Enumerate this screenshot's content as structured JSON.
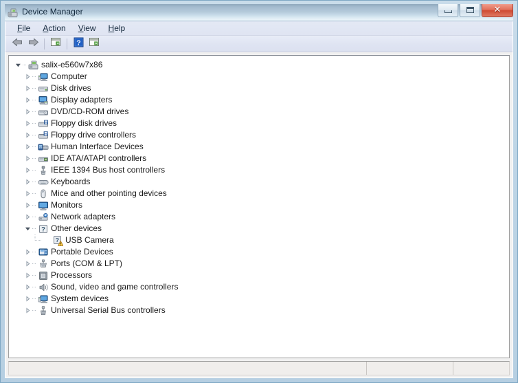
{
  "window": {
    "title": "Device Manager",
    "title_icon": "device-manager-icon",
    "controls": {
      "minimize_label": "Minimize",
      "maximize_label": "Maximize",
      "close_label": "Close",
      "close_glyph": "✕"
    }
  },
  "menubar": {
    "items": [
      {
        "label": "File",
        "accel": "F",
        "name": "menu-file"
      },
      {
        "label": "Action",
        "accel": "A",
        "name": "menu-action"
      },
      {
        "label": "View",
        "accel": "V",
        "name": "menu-view"
      },
      {
        "label": "Help",
        "accel": "H",
        "name": "menu-help"
      }
    ]
  },
  "toolbar": {
    "buttons": [
      {
        "name": "back-button",
        "icon": "back-arrow-icon",
        "label": "Back"
      },
      {
        "name": "forward-button",
        "icon": "forward-arrow-icon",
        "label": "Forward"
      },
      {
        "name": "show-hide-console-tree-button",
        "icon": "console-tree-icon",
        "label": "Show/Hide Console Tree"
      },
      {
        "name": "help-button",
        "icon": "help-question-icon",
        "label": "Help"
      },
      {
        "name": "properties-button",
        "icon": "properties-window-icon",
        "label": "Properties"
      }
    ]
  },
  "tree": {
    "root": {
      "label": "salix-e560w7x86",
      "icon": "computer-root-icon",
      "expanded": true
    },
    "items": [
      {
        "label": "Computer",
        "icon": "computer-icon",
        "expandable": true,
        "expanded": false,
        "level": 1
      },
      {
        "label": "Disk drives",
        "icon": "disk-drive-icon",
        "expandable": true,
        "expanded": false,
        "level": 1
      },
      {
        "label": "Display adapters",
        "icon": "display-adapter-icon",
        "expandable": true,
        "expanded": false,
        "level": 1
      },
      {
        "label": "DVD/CD-ROM drives",
        "icon": "dvd-cdrom-icon",
        "expandable": true,
        "expanded": false,
        "level": 1
      },
      {
        "label": "Floppy disk drives",
        "icon": "floppy-disk-icon",
        "expandable": true,
        "expanded": false,
        "level": 1
      },
      {
        "label": "Floppy drive controllers",
        "icon": "floppy-controller-icon",
        "expandable": true,
        "expanded": false,
        "level": 1
      },
      {
        "label": "Human Interface Devices",
        "icon": "hid-icon",
        "expandable": true,
        "expanded": false,
        "level": 1
      },
      {
        "label": "IDE ATA/ATAPI controllers",
        "icon": "ide-controller-icon",
        "expandable": true,
        "expanded": false,
        "level": 1
      },
      {
        "label": "IEEE 1394 Bus host controllers",
        "icon": "ieee1394-icon",
        "expandable": true,
        "expanded": false,
        "level": 1
      },
      {
        "label": "Keyboards",
        "icon": "keyboard-icon",
        "expandable": true,
        "expanded": false,
        "level": 1
      },
      {
        "label": "Mice and other pointing devices",
        "icon": "mouse-icon",
        "expandable": true,
        "expanded": false,
        "level": 1
      },
      {
        "label": "Monitors",
        "icon": "monitor-icon",
        "expandable": true,
        "expanded": false,
        "level": 1
      },
      {
        "label": "Network adapters",
        "icon": "network-adapter-icon",
        "expandable": true,
        "expanded": false,
        "level": 1
      },
      {
        "label": "Other devices",
        "icon": "other-devices-icon",
        "expandable": true,
        "expanded": true,
        "level": 1
      },
      {
        "label": "USB Camera",
        "icon": "unknown-device-warning-icon",
        "expandable": false,
        "expanded": false,
        "level": 2,
        "warning": true
      },
      {
        "label": "Portable Devices",
        "icon": "portable-device-icon",
        "expandable": true,
        "expanded": false,
        "level": 1
      },
      {
        "label": "Ports (COM & LPT)",
        "icon": "ports-icon",
        "expandable": true,
        "expanded": false,
        "level": 1
      },
      {
        "label": "Processors",
        "icon": "processor-icon",
        "expandable": true,
        "expanded": false,
        "level": 1
      },
      {
        "label": "Sound, video and game controllers",
        "icon": "sound-icon",
        "expandable": true,
        "expanded": false,
        "level": 1
      },
      {
        "label": "System devices",
        "icon": "system-device-icon",
        "expandable": true,
        "expanded": false,
        "level": 1
      },
      {
        "label": "Universal Serial Bus controllers",
        "icon": "usb-controller-icon",
        "expandable": true,
        "expanded": false,
        "level": 1
      }
    ]
  },
  "statusbar": {
    "pane1": "",
    "pane2": "",
    "pane3": ""
  },
  "colors": {
    "warning_yellow": "#ffd24a",
    "close_red": "#cf4a32",
    "title_blue": "#b3c9da",
    "tree_bg": "#ffffff"
  }
}
